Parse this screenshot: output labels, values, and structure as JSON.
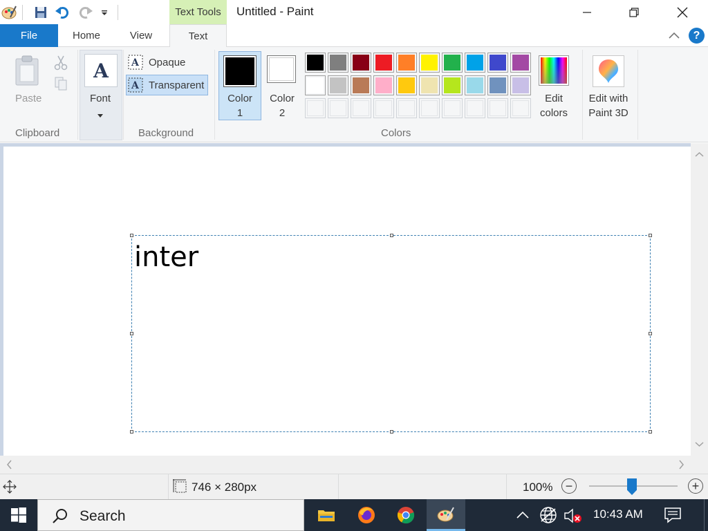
{
  "titlebar": {
    "context_group": "Text Tools",
    "window_title": "Untitled - Paint"
  },
  "tabs": {
    "file": "File",
    "home": "Home",
    "view": "View",
    "text": "Text"
  },
  "ribbon": {
    "clipboard": {
      "paste_label": "Paste",
      "group_label": "Clipboard"
    },
    "font": {
      "label": "Font"
    },
    "background": {
      "opaque_label": "Opaque",
      "transparent_label": "Transparent",
      "group_label": "Background"
    },
    "colors": {
      "color1_label": "Color 1",
      "color1_line1": "Color",
      "color1_line2": "1",
      "color2_line1": "Color",
      "color2_line2": "2",
      "color1_value": "#000000",
      "color2_value": "#ffffff",
      "palette_row1": [
        "#000000",
        "#7f7f7f",
        "#880015",
        "#ed1c24",
        "#ff7f27",
        "#fff200",
        "#22b14c",
        "#00a2e8",
        "#3f48cc",
        "#a349a4"
      ],
      "palette_row2": [
        "#ffffff",
        "#c3c3c3",
        "#b97a57",
        "#ffaec9",
        "#ffc90e",
        "#efe4b0",
        "#b5e61d",
        "#99d9ea",
        "#7092be",
        "#c8bfe7"
      ],
      "palette_row3": [
        "#f5f6f7",
        "#f5f6f7",
        "#f5f6f7",
        "#f5f6f7",
        "#f5f6f7",
        "#f5f6f7",
        "#f5f6f7",
        "#f5f6f7",
        "#f5f6f7",
        "#f5f6f7"
      ],
      "edit_line1": "Edit",
      "edit_line2": "colors",
      "group_label": "Colors"
    },
    "paint3d": {
      "line1": "Edit with",
      "line2": "Paint 3D"
    }
  },
  "canvas": {
    "text": "inter"
  },
  "statusbar": {
    "dimensions": "746 × 280px",
    "zoom": "100%",
    "zoom_level_percent": 100
  },
  "taskbar": {
    "search_placeholder": "Search",
    "time": "10:43 AM"
  },
  "colors": {
    "accent": "#1979ca",
    "context_tab": "#d6f0b6",
    "taskbar_bg": "#1f2a38",
    "workspace_bg": "#cad5e5"
  }
}
